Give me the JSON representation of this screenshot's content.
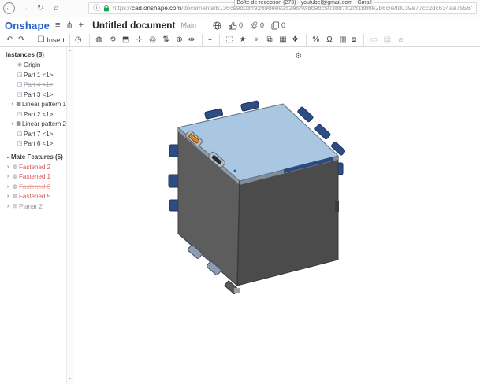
{
  "colors": {
    "brand-blue": "#2563c9",
    "error-red": "#d9534f",
    "model-top": "#aac7e2",
    "model-left": "#5d5d5d",
    "model-right": "#4b4b4b",
    "model-tab": "#2e4d85",
    "model-orange": "#d98a26",
    "lock-green": "#12a452"
  },
  "icons": {
    "back": "←",
    "forward": "→",
    "reload": "↻",
    "home": "⌂",
    "info": "ⓘ",
    "menu": "≡",
    "versions": "⋔",
    "add": "+",
    "gear": "⚙",
    "scroll_up": "⌃",
    "scroll_down": "⌄",
    "chevron_collapsed": "›",
    "chevron_expanded": "⌄"
  },
  "browser": {
    "tab_tooltip": "Boîte de réception (273) - youtubel@gmail.com - Gmail",
    "url_scheme": "https://",
    "url_domain": "cad.onshape.com",
    "url_path": "/documents/b136c99d0349269dee9252e5/w/8c9bc503bd782f61bb6e2b6c/e/fd039e77cc2dc634aa7556f6"
  },
  "header": {
    "logo": "Onshape",
    "document_title": "Untitled document",
    "workspace": "Main",
    "likes_count": "0",
    "links_count": "0",
    "copies_count": "0"
  },
  "toolbar": {
    "items": [
      {
        "name": "undo-button",
        "glyph": "↶"
      },
      {
        "name": "redo-button",
        "glyph": "↷",
        "cls": "sep-after"
      },
      {
        "name": "insert-button",
        "glyph": "❏",
        "label": "Insert",
        "cls": "sep-after"
      },
      {
        "name": "history-button",
        "glyph": "◷",
        "cls": "sep-after"
      },
      {
        "name": "fastened-mate-icon",
        "glyph": "◍"
      },
      {
        "name": "revolute-mate-icon",
        "glyph": "⟲"
      },
      {
        "name": "planar-mate-icon",
        "glyph": "⬒"
      },
      {
        "name": "translate-tool-icon",
        "glyph": "⊹"
      },
      {
        "name": "rotate-tool-icon",
        "glyph": "◎"
      },
      {
        "name": "slider-mate-icon",
        "glyph": "⇅"
      },
      {
        "name": "cylindrical-mate-icon",
        "glyph": "⊕"
      },
      {
        "name": "parallel-mate-icon",
        "glyph": "⇹",
        "cls": "sep-after"
      },
      {
        "name": "snap-mode-icon",
        "glyph": "⌁",
        "cls": "sep-after"
      },
      {
        "name": "select-other-icon",
        "glyph": "⬚"
      },
      {
        "name": "favorite-icon",
        "glyph": "★"
      },
      {
        "name": "mate-connector-icon",
        "glyph": "⌖"
      },
      {
        "name": "group-icon",
        "glyph": "⧉"
      },
      {
        "name": "linear-pattern-icon",
        "glyph": "▦"
      },
      {
        "name": "replicate-icon",
        "glyph": "❖",
        "cls": "sep-after"
      },
      {
        "name": "interference-icon",
        "glyph": "%"
      },
      {
        "name": "named-positions-icon",
        "glyph": "Ω"
      },
      {
        "name": "section-view-icon",
        "glyph": "▥"
      },
      {
        "name": "display-states-icon",
        "glyph": "⧈",
        "cls": "sep-after"
      },
      {
        "name": "hide-instances-icon",
        "glyph": "▭",
        "cls": "disabled"
      },
      {
        "name": "appearance-icon",
        "glyph": "▤",
        "cls": "disabled"
      },
      {
        "name": "measure-icon",
        "glyph": "⌀",
        "cls": "disabled"
      }
    ]
  },
  "sidebar": {
    "instances_header": "Instances (8)",
    "instances": [
      {
        "label": "Origin",
        "glyph": "◉",
        "cls": "origin"
      },
      {
        "label": "Part 1 <1>",
        "glyph": "◳"
      },
      {
        "label": "Part 4 <1>",
        "glyph": "◳",
        "cls": "suppressed"
      },
      {
        "label": "Part 3 <1>",
        "glyph": "◳"
      },
      {
        "label": "Linear pattern 1",
        "glyph": "▦",
        "chevron": "›",
        "cls": "pattern"
      },
      {
        "label": "Part 2 <1>",
        "glyph": "◳"
      },
      {
        "label": "Linear pattern 2",
        "glyph": "▦",
        "chevron": "›",
        "cls": "pattern"
      },
      {
        "label": "Part 7 <1>",
        "glyph": "◳"
      },
      {
        "label": "Part 6 <1>",
        "glyph": "◳"
      }
    ],
    "mates_header": "Mate Features (5)",
    "mates": [
      {
        "label": "Fastened 2",
        "glyph": "◍",
        "chevron": "›",
        "cls": "error"
      },
      {
        "label": "Fastened 1",
        "glyph": "◍",
        "chevron": "›",
        "cls": "error"
      },
      {
        "label": "Fastened 3",
        "glyph": "◍",
        "chevron": "›",
        "cls": "error suppressed"
      },
      {
        "label": "Fastened 5",
        "glyph": "◍",
        "chevron": "›",
        "cls": "error"
      },
      {
        "label": "Planar 2",
        "glyph": "⊞",
        "chevron": "›",
        "cls": "muted"
      }
    ]
  }
}
